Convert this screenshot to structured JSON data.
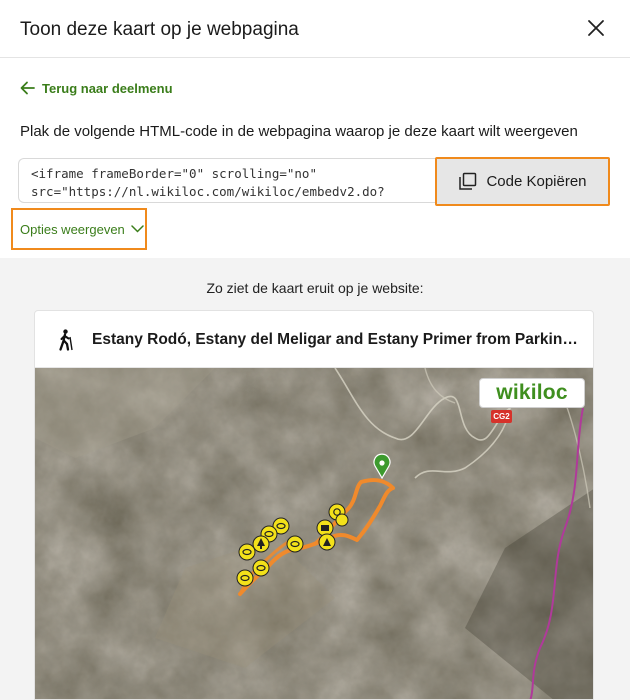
{
  "dialog": {
    "title": "Toon deze kaart op je webpagina",
    "close_icon": "close-icon"
  },
  "back_link": {
    "label": "Terug naar deelmenu",
    "icon": "arrow-left-icon"
  },
  "instruction": "Plak de volgende HTML-code in de webpagina waarop je deze kaart wilt weergeven",
  "code": {
    "line1": "<iframe frameBorder=\"0\" scrolling=\"no\"",
    "line2": "src=\"https://nl.wikiloc.com/wikiloc/embedv2.do?"
  },
  "copy_button": {
    "label": "Code Kopiëren",
    "icon": "copy-icon"
  },
  "options_toggle": {
    "label": "Opties weergeven",
    "icon": "chevron-down-icon"
  },
  "preview": {
    "label": "Zo ziet de kaart eruit op je website:",
    "trail_title": "Estany Rodó, Estany del Meligar and Estany Primer from Parking ...",
    "activity_icon": "hiking-icon",
    "map": {
      "logo": "wikiloc",
      "road_badge": "CG2"
    }
  },
  "colors": {
    "accent_green": "#3a7d1a",
    "highlight_orange": "#f08a1c",
    "track_orange": "#f08a2c",
    "waypoint_yellow": "#f3e11a"
  }
}
